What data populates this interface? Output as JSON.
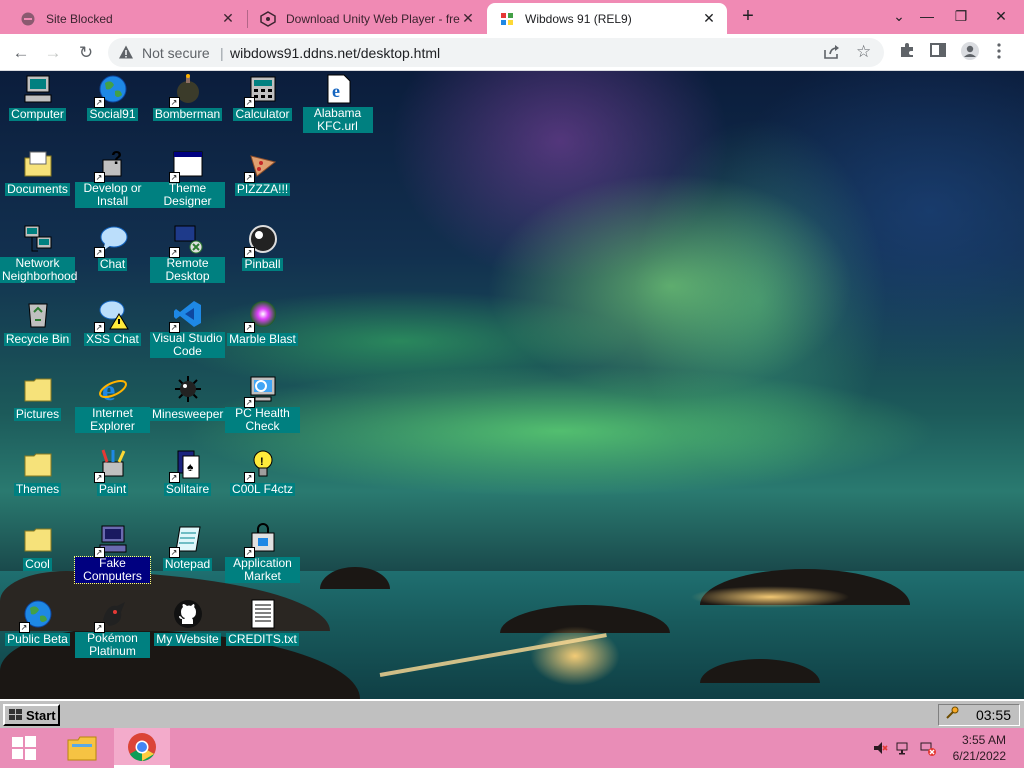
{
  "tabs": [
    {
      "title": "Site Blocked",
      "icon": "blocked-icon",
      "active": false
    },
    {
      "title": "Download Unity Web Player - fre",
      "icon": "unity-icon",
      "active": false
    },
    {
      "title": "Wibdows 91 (REL9)",
      "icon": "windows-flag-icon",
      "active": true
    }
  ],
  "toolbar": {
    "security_label": "Not secure",
    "separator": "|",
    "url": "wibdows91.ddns.net/desktop.html"
  },
  "desktop": {
    "icons": [
      {
        "label": "Computer",
        "icon": "computer-icon",
        "shortcut": false
      },
      {
        "label": "Social91",
        "icon": "globe-icon",
        "shortcut": true
      },
      {
        "label": "Bomberman",
        "icon": "bomb-icon",
        "shortcut": true
      },
      {
        "label": "Calculator",
        "icon": "calculator-icon",
        "shortcut": true
      },
      {
        "label": "Alabama KFC.url",
        "icon": "ie-link-icon",
        "shortcut": false
      },
      {
        "label": "Documents",
        "icon": "documents-folder-icon",
        "shortcut": false
      },
      {
        "label": "Develop or Install",
        "icon": "help-install-icon",
        "shortcut": true
      },
      {
        "label": "Theme Designer",
        "icon": "window-icon",
        "shortcut": true
      },
      {
        "label": "PIZZZA!!!",
        "icon": "pizza-icon",
        "shortcut": true
      },
      {
        "label": "Network Neighborhood",
        "icon": "network-icon",
        "shortcut": false
      },
      {
        "label": "Chat",
        "icon": "chat-bubble-icon",
        "shortcut": true
      },
      {
        "label": "Remote Desktop",
        "icon": "remote-desktop-icon",
        "shortcut": true
      },
      {
        "label": "Pinball",
        "icon": "pinball-icon",
        "shortcut": true
      },
      {
        "label": "Recycle Bin",
        "icon": "recycle-bin-icon",
        "shortcut": false
      },
      {
        "label": "XSS Chat",
        "icon": "warning-chat-icon",
        "shortcut": true
      },
      {
        "label": "Visual Studio Code",
        "icon": "vscode-icon",
        "shortcut": true
      },
      {
        "label": "Marble Blast",
        "icon": "marble-icon",
        "shortcut": true
      },
      {
        "label": "Pictures",
        "icon": "folder-icon",
        "shortcut": false
      },
      {
        "label": "Internet Explorer",
        "icon": "internet-explorer-icon",
        "shortcut": false
      },
      {
        "label": "Minesweeper",
        "icon": "mine-icon",
        "shortcut": false
      },
      {
        "label": "PC Health Check",
        "icon": "health-check-icon",
        "shortcut": true
      },
      {
        "label": "Themes",
        "icon": "folder-icon",
        "shortcut": false
      },
      {
        "label": "Paint",
        "icon": "paint-icon",
        "shortcut": true
      },
      {
        "label": "Solitaire",
        "icon": "cards-icon",
        "shortcut": true
      },
      {
        "label": "C00L F4ctz",
        "icon": "lightbulb-icon",
        "shortcut": true
      },
      {
        "label": "Cool",
        "icon": "folder-icon",
        "shortcut": false
      },
      {
        "label": "Fake Computers",
        "icon": "computer-icon",
        "shortcut": true,
        "selected": true
      },
      {
        "label": "Notepad",
        "icon": "notepad-icon",
        "shortcut": true
      },
      {
        "label": "Application Market",
        "icon": "shopping-bag-icon",
        "shortcut": true
      },
      {
        "label": "Public Beta",
        "icon": "globe-icon",
        "shortcut": true
      },
      {
        "label": "Pokémon Platinum",
        "icon": "pokemon-icon",
        "shortcut": true
      },
      {
        "label": "My Website",
        "icon": "github-icon",
        "shortcut": false
      },
      {
        "label": "CREDITS.txt",
        "icon": "text-file-icon",
        "shortcut": false
      }
    ]
  },
  "w91_taskbar": {
    "start_label": "Start",
    "clock": "03:55"
  },
  "windows_taskbar": {
    "time": "3:55 AM",
    "date": "6/21/2022"
  },
  "colors": {
    "tab_strip": "#f08ab4",
    "win_taskbar": "#e98db7",
    "icon_label_bg": "#008080",
    "icon_label_selected": "#000080"
  }
}
